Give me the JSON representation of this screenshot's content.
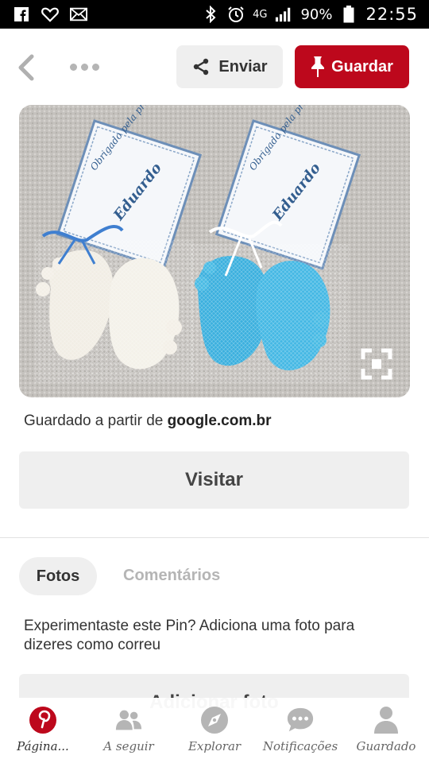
{
  "status_bar": {
    "network": "4G",
    "battery": "90%",
    "time": "22:55"
  },
  "header": {
    "send_label": "Enviar",
    "save_label": "Guardar"
  },
  "pin": {
    "card_text_1": "Obrigado pela presença!",
    "card_text_2": "Eduardo",
    "saved_from_prefix": "Guardado a partir de ",
    "saved_from_domain": "google.com.br",
    "visit_label": "Visitar"
  },
  "tabs": {
    "photos": "Fotos",
    "comments": "Comentários"
  },
  "prompt": {
    "text": "Experimentaste este Pin? Adiciona uma foto para dizeres como correu",
    "add_photo_label": "Adicionar foto"
  },
  "bottom_nav": [
    {
      "label": "Página...",
      "icon": "pinterest-logo-icon",
      "active": true
    },
    {
      "label": "A seguir",
      "icon": "people-icon",
      "active": false
    },
    {
      "label": "Explorar",
      "icon": "compass-icon",
      "active": false
    },
    {
      "label": "Notificações",
      "icon": "speech-bubble-icon",
      "active": false
    },
    {
      "label": "Guardado",
      "icon": "person-icon",
      "active": false
    }
  ],
  "colors": {
    "brand_red": "#bd081c",
    "button_gray": "#efefef",
    "icon_gray": "#b5b5b5"
  }
}
